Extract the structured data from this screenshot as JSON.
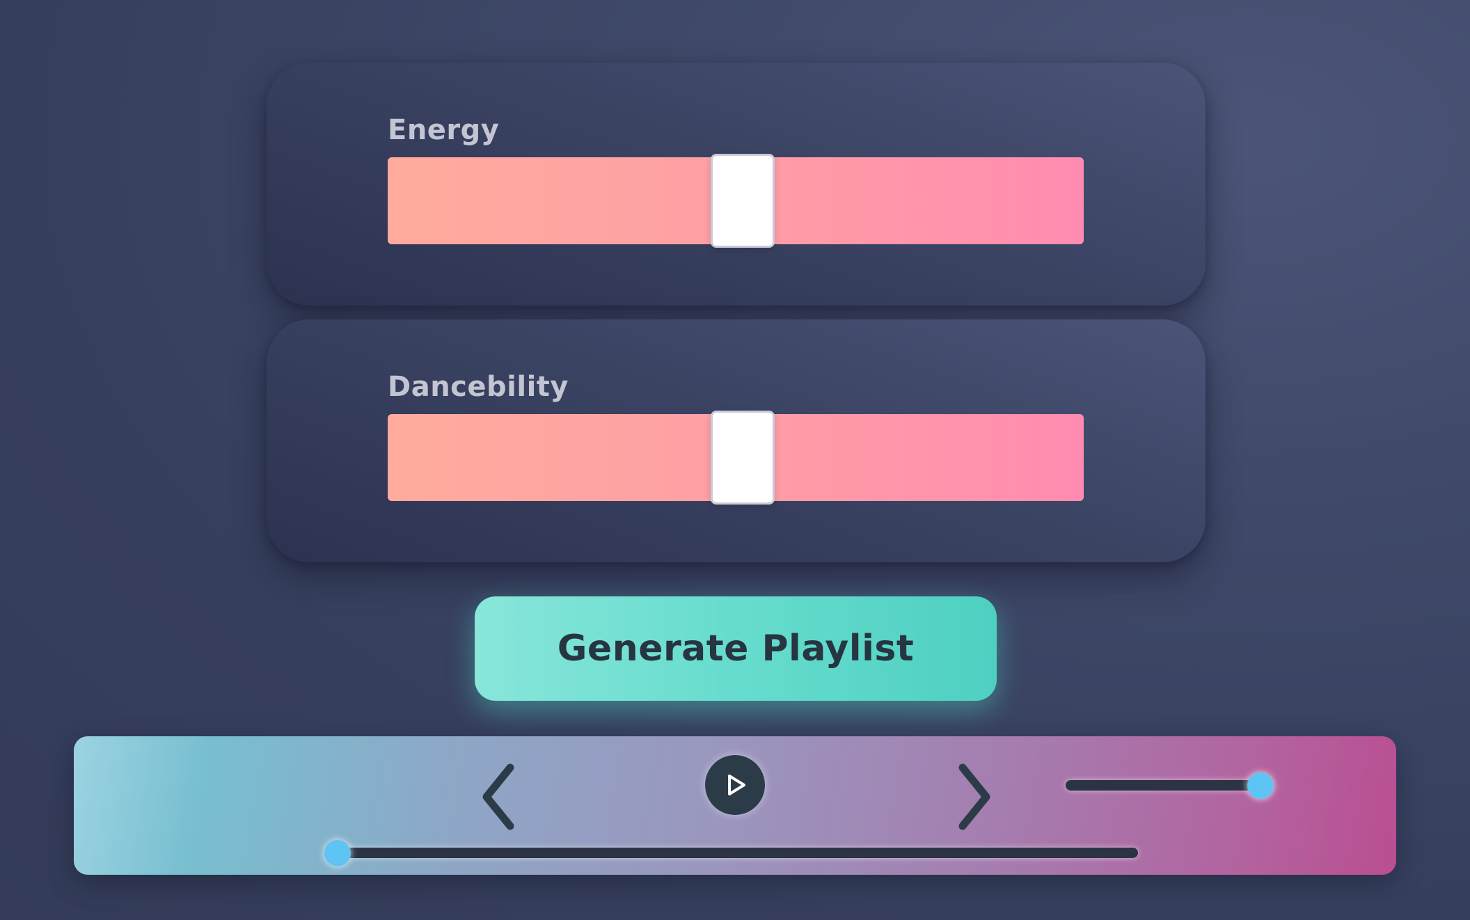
{
  "sliders": [
    {
      "label": "Energy",
      "value_percent": 51
    },
    {
      "label": "Dancebility",
      "value_percent": 51
    }
  ],
  "generate_button": {
    "label": "Generate Playlist"
  },
  "player": {
    "volume_percent": 100,
    "progress_percent": 0,
    "icons": [
      "chevron-left-icon",
      "play-icon",
      "chevron-right-icon"
    ]
  },
  "colors": {
    "slider_track_start": "#ffab9e",
    "slider_track_end": "#ff8cb0",
    "button_accent": "#5ed8c9",
    "knob": "#5ec4f4",
    "player_start": "#78bfd0",
    "player_end": "#ba4e91"
  }
}
